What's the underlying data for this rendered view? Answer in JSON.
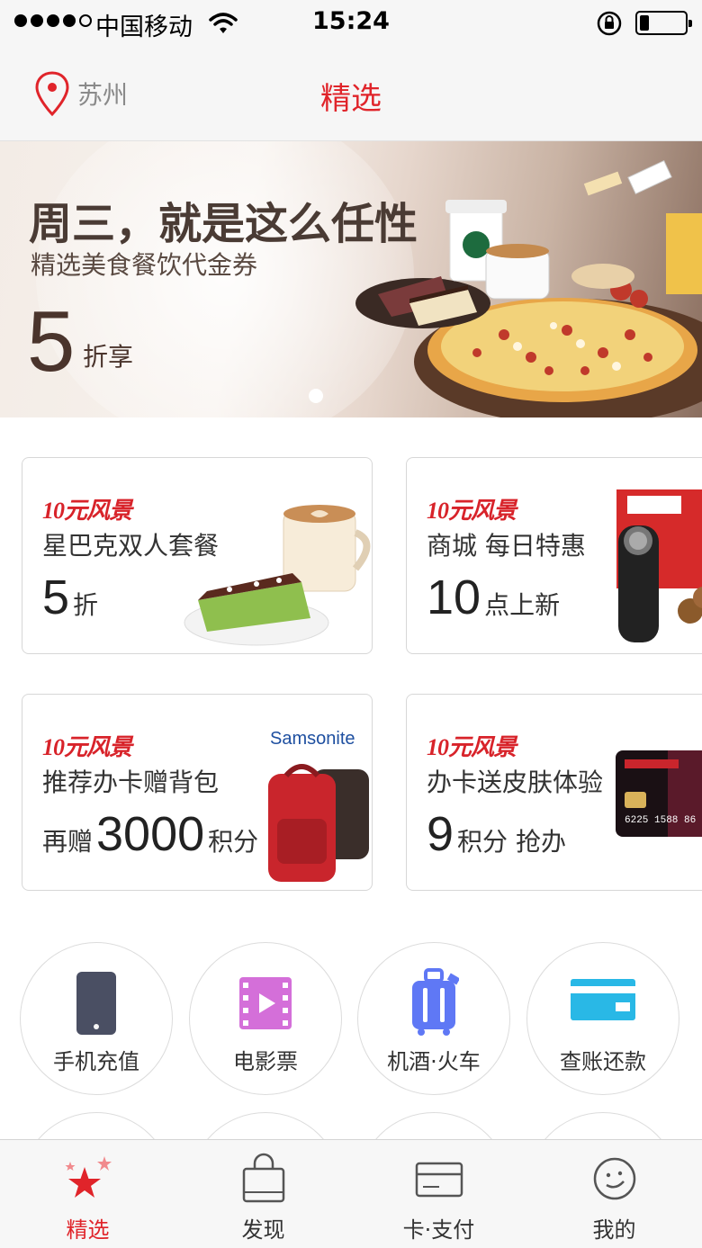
{
  "status_bar": {
    "carrier": "中国移动",
    "time": "15:24",
    "signal_icon": "signal-dots-icon",
    "wifi_icon": "wifi-icon",
    "lock_icon": "rotation-lock-icon",
    "battery_icon": "battery-icon",
    "battery_level": 0.2
  },
  "nav": {
    "location_icon": "location-pin-icon",
    "city": "苏州",
    "title": "精选"
  },
  "banner": {
    "headline": "周三，就是这么任性",
    "subtitle": "精选美食餐饮代金券",
    "discount_value": "5",
    "discount_unit": "折享",
    "page_index": 1
  },
  "cards": [
    {
      "brand": "10元风景",
      "title": "星巴克双人套餐",
      "prefix": "",
      "value": "5",
      "suffix": "折",
      "art": "coffee-cake-image"
    },
    {
      "brand": "10元风景",
      "title": "商城 每日特惠",
      "prefix": "",
      "value": "10",
      "suffix": "点上新",
      "art": "shaver-products-image"
    },
    {
      "brand": "10元风景",
      "title": "推荐办卡赠背包",
      "prefix": "再赠",
      "value": "3000",
      "suffix": "积分",
      "art": "samsonite-backpack-image",
      "logo": "Samsonite"
    },
    {
      "brand": "10元风景",
      "title": "办卡送皮肤体验",
      "prefix": "",
      "value": "9",
      "suffix": "积分 抢办",
      "art": "credit-card-image",
      "card_number": "6225 1588 86"
    }
  ],
  "services": [
    {
      "label": "手机充值",
      "icon": "mobile-phone-icon",
      "color": "#4a4f63"
    },
    {
      "label": "电影票",
      "icon": "film-ticket-icon",
      "color": "#d46fd9"
    },
    {
      "label": "机酒·火车",
      "icon": "luggage-icon",
      "color": "#5f78f5"
    },
    {
      "label": "查账还款",
      "icon": "bank-card-icon",
      "color": "#29b8e6"
    }
  ],
  "tabs": [
    {
      "label": "精选",
      "icon": "stars-icon",
      "active": true
    },
    {
      "label": "发现",
      "icon": "shopping-bag-icon",
      "active": false
    },
    {
      "label": "卡·支付",
      "icon": "card-icon",
      "active": false
    },
    {
      "label": "我的",
      "icon": "smiley-face-icon",
      "active": false
    }
  ],
  "colors": {
    "accent": "#e0242a",
    "text": "#333333",
    "muted": "#8a8a8a"
  }
}
